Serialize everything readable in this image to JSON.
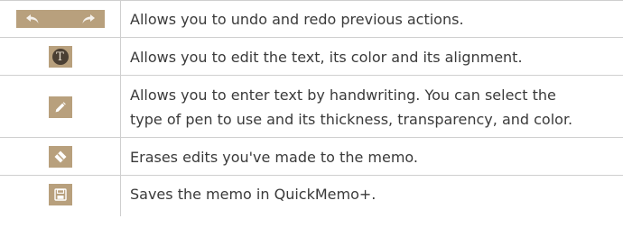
{
  "rows": [
    {
      "icons": [
        "undo-icon",
        "redo-icon"
      ],
      "description": "Allows you to undo and redo previous actions."
    },
    {
      "icons": [
        "text-icon"
      ],
      "icon_letter": "T",
      "description": "Allows you to edit the text, its color and its alignment."
    },
    {
      "icons": [
        "pen-icon"
      ],
      "description_lines": [
        "Allows you to enter text by handwriting. You can select the",
        "type of pen to use and its thickness, transparency, and color."
      ]
    },
    {
      "icons": [
        "eraser-icon"
      ],
      "description": "Erases edits you've made to the memo."
    },
    {
      "icons": [
        "save-icon"
      ],
      "description": "Saves the memo in QuickMemo+."
    }
  ],
  "colors": {
    "icon_background": "#b8a07d",
    "text": "#3a3a3a",
    "rule": "#cfcfcf"
  }
}
